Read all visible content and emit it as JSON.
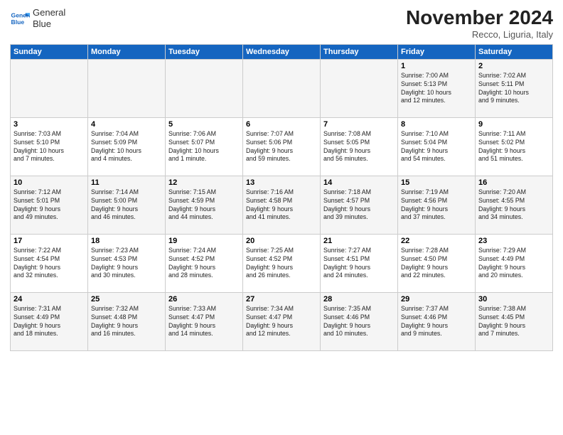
{
  "logo": {
    "line1": "General",
    "line2": "Blue"
  },
  "title": "November 2024",
  "subtitle": "Recco, Liguria, Italy",
  "days_of_week": [
    "Sunday",
    "Monday",
    "Tuesday",
    "Wednesday",
    "Thursday",
    "Friday",
    "Saturday"
  ],
  "weeks": [
    [
      {
        "num": "",
        "info": ""
      },
      {
        "num": "",
        "info": ""
      },
      {
        "num": "",
        "info": ""
      },
      {
        "num": "",
        "info": ""
      },
      {
        "num": "",
        "info": ""
      },
      {
        "num": "1",
        "info": "Sunrise: 7:00 AM\nSunset: 5:13 PM\nDaylight: 10 hours\nand 12 minutes."
      },
      {
        "num": "2",
        "info": "Sunrise: 7:02 AM\nSunset: 5:11 PM\nDaylight: 10 hours\nand 9 minutes."
      }
    ],
    [
      {
        "num": "3",
        "info": "Sunrise: 7:03 AM\nSunset: 5:10 PM\nDaylight: 10 hours\nand 7 minutes."
      },
      {
        "num": "4",
        "info": "Sunrise: 7:04 AM\nSunset: 5:09 PM\nDaylight: 10 hours\nand 4 minutes."
      },
      {
        "num": "5",
        "info": "Sunrise: 7:06 AM\nSunset: 5:07 PM\nDaylight: 10 hours\nand 1 minute."
      },
      {
        "num": "6",
        "info": "Sunrise: 7:07 AM\nSunset: 5:06 PM\nDaylight: 9 hours\nand 59 minutes."
      },
      {
        "num": "7",
        "info": "Sunrise: 7:08 AM\nSunset: 5:05 PM\nDaylight: 9 hours\nand 56 minutes."
      },
      {
        "num": "8",
        "info": "Sunrise: 7:10 AM\nSunset: 5:04 PM\nDaylight: 9 hours\nand 54 minutes."
      },
      {
        "num": "9",
        "info": "Sunrise: 7:11 AM\nSunset: 5:02 PM\nDaylight: 9 hours\nand 51 minutes."
      }
    ],
    [
      {
        "num": "10",
        "info": "Sunrise: 7:12 AM\nSunset: 5:01 PM\nDaylight: 9 hours\nand 49 minutes."
      },
      {
        "num": "11",
        "info": "Sunrise: 7:14 AM\nSunset: 5:00 PM\nDaylight: 9 hours\nand 46 minutes."
      },
      {
        "num": "12",
        "info": "Sunrise: 7:15 AM\nSunset: 4:59 PM\nDaylight: 9 hours\nand 44 minutes."
      },
      {
        "num": "13",
        "info": "Sunrise: 7:16 AM\nSunset: 4:58 PM\nDaylight: 9 hours\nand 41 minutes."
      },
      {
        "num": "14",
        "info": "Sunrise: 7:18 AM\nSunset: 4:57 PM\nDaylight: 9 hours\nand 39 minutes."
      },
      {
        "num": "15",
        "info": "Sunrise: 7:19 AM\nSunset: 4:56 PM\nDaylight: 9 hours\nand 37 minutes."
      },
      {
        "num": "16",
        "info": "Sunrise: 7:20 AM\nSunset: 4:55 PM\nDaylight: 9 hours\nand 34 minutes."
      }
    ],
    [
      {
        "num": "17",
        "info": "Sunrise: 7:22 AM\nSunset: 4:54 PM\nDaylight: 9 hours\nand 32 minutes."
      },
      {
        "num": "18",
        "info": "Sunrise: 7:23 AM\nSunset: 4:53 PM\nDaylight: 9 hours\nand 30 minutes."
      },
      {
        "num": "19",
        "info": "Sunrise: 7:24 AM\nSunset: 4:52 PM\nDaylight: 9 hours\nand 28 minutes."
      },
      {
        "num": "20",
        "info": "Sunrise: 7:25 AM\nSunset: 4:52 PM\nDaylight: 9 hours\nand 26 minutes."
      },
      {
        "num": "21",
        "info": "Sunrise: 7:27 AM\nSunset: 4:51 PM\nDaylight: 9 hours\nand 24 minutes."
      },
      {
        "num": "22",
        "info": "Sunrise: 7:28 AM\nSunset: 4:50 PM\nDaylight: 9 hours\nand 22 minutes."
      },
      {
        "num": "23",
        "info": "Sunrise: 7:29 AM\nSunset: 4:49 PM\nDaylight: 9 hours\nand 20 minutes."
      }
    ],
    [
      {
        "num": "24",
        "info": "Sunrise: 7:31 AM\nSunset: 4:49 PM\nDaylight: 9 hours\nand 18 minutes."
      },
      {
        "num": "25",
        "info": "Sunrise: 7:32 AM\nSunset: 4:48 PM\nDaylight: 9 hours\nand 16 minutes."
      },
      {
        "num": "26",
        "info": "Sunrise: 7:33 AM\nSunset: 4:47 PM\nDaylight: 9 hours\nand 14 minutes."
      },
      {
        "num": "27",
        "info": "Sunrise: 7:34 AM\nSunset: 4:47 PM\nDaylight: 9 hours\nand 12 minutes."
      },
      {
        "num": "28",
        "info": "Sunrise: 7:35 AM\nSunset: 4:46 PM\nDaylight: 9 hours\nand 10 minutes."
      },
      {
        "num": "29",
        "info": "Sunrise: 7:37 AM\nSunset: 4:46 PM\nDaylight: 9 hours\nand 9 minutes."
      },
      {
        "num": "30",
        "info": "Sunrise: 7:38 AM\nSunset: 4:45 PM\nDaylight: 9 hours\nand 7 minutes."
      }
    ]
  ]
}
